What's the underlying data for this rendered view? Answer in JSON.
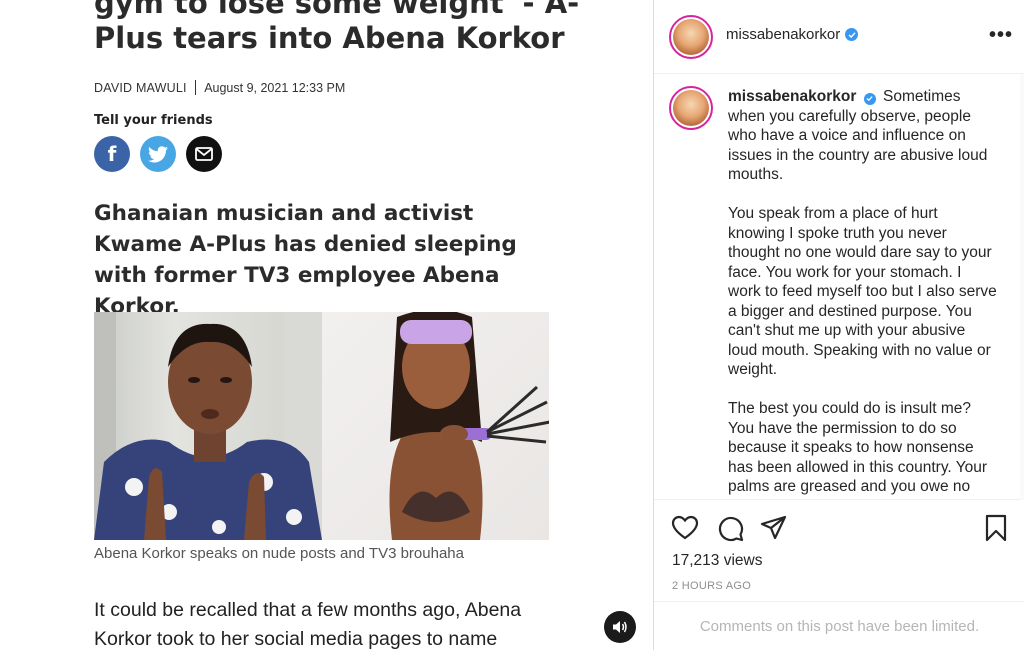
{
  "article": {
    "headline": "gym to lose some weight' - A-Plus tears into Abena Korkor",
    "author": "DAVID MAWULI",
    "date": "August 9, 2021 12:33 PM",
    "share_label": "Tell your friends",
    "share_icons": [
      "facebook-icon",
      "twitter-icon",
      "email-icon"
    ],
    "lede": "Ghanaian musician and activist Kwame A-Plus has denied sleeping with former TV3 employee Abena Korkor.",
    "photo_caption": "Abena Korkor speaks on nude posts and TV3 brouhaha",
    "body": "It could be recalled that a few months ago, Abena Korkor took to her social media pages to name"
  },
  "instagram": {
    "username": "missabenakorkor",
    "caption_p1": "Sometimes when you carefully observe, people who have a voice and influence on issues in the country are abusive loud mouths.",
    "caption_p2": "You speak from a place of hurt knowing I spoke truth you never thought no one would dare say to your face. You work for your stomach. I work to feed myself too but I also serve a bigger and destined purpose. You can't shut me up with your abusive loud mouth. Speaking with no value or weight.",
    "caption_p3": "The best you could do is insult me? You have the permission to do so because it speaks to how nonsense has been allowed in this country. Your palms are greased and you owe no loyalty to the country or universe at",
    "views": "17,213 views",
    "time": "2 HOURS AGO",
    "comments_limited": "Comments on this post have been limited.",
    "colors": {
      "verified": "#3897f0",
      "ring": "#d6249f",
      "facebook": "#3a63a8",
      "twitter": "#49a6e5"
    }
  }
}
